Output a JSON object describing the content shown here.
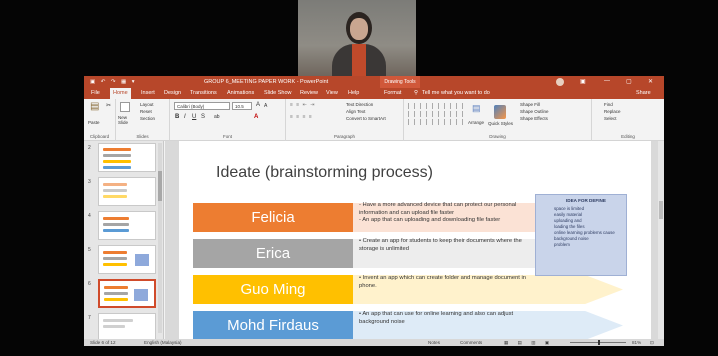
{
  "window": {
    "title": "GROUP 6_MEETING PAPER WORK - PowerPoint",
    "drawing_tools": "Drawing Tools",
    "quick_access": "▣ ↶ ↷ ▦ ▾",
    "min": "—",
    "max": "▢",
    "close": "✕",
    "ribbon_display": "▣"
  },
  "tabs": [
    {
      "label": "File"
    },
    {
      "label": "Home"
    },
    {
      "label": "Insert"
    },
    {
      "label": "Design"
    },
    {
      "label": "Transitions"
    },
    {
      "label": "Animations"
    },
    {
      "label": "Slide Show"
    },
    {
      "label": "Review"
    },
    {
      "label": "View"
    },
    {
      "label": "Help"
    },
    {
      "label": "Format"
    },
    {
      "label": "Tell me what you want to do"
    },
    {
      "label": "Share"
    }
  ],
  "ribbon": {
    "clipboard": {
      "label": "Clipboard",
      "paste": "Paste"
    },
    "slides": {
      "label": "Slides",
      "new_slide": "New Slide",
      "layout": "Layout",
      "reset": "Reset",
      "section": "Section"
    },
    "font": {
      "label": "Font",
      "font_name": "Calibri (Body)",
      "font_size": "10.5",
      "bold": "B",
      "italic": "I",
      "underline": "U",
      "strike": "S",
      "grow": "A",
      "shrink": "A",
      "font_color": "A",
      "highlight": "ab"
    },
    "paragraph": {
      "label": "Paragraph",
      "text_direction": "Text Direction",
      "align_text": "Align Text",
      "convert_smartart": "Convert to SmartArt"
    },
    "drawing": {
      "label": "Drawing",
      "arrange": "Arrange",
      "quick_styles": "Quick Styles",
      "shape_fill": "Shape Fill",
      "shape_outline": "Shape Outline",
      "shape_effects": "Shape Effects"
    },
    "editing": {
      "label": "Editing",
      "find": "Find",
      "replace": "Replace",
      "select": "Select"
    }
  },
  "thumbnails": [
    {
      "num": "2"
    },
    {
      "num": "3"
    },
    {
      "num": "4"
    },
    {
      "num": "5"
    },
    {
      "num": "6"
    },
    {
      "num": "7"
    }
  ],
  "slide": {
    "title": "Ideate (brainstorming process)",
    "rows": [
      {
        "name": "Felicia",
        "color": "#ed7d31",
        "arrow": "#fbe2d5",
        "lines": [
          "- Have a more advanced device that can protect our personal",
          "  information and can upload file faster",
          "- An app that can uploading and downloading file faster"
        ]
      },
      {
        "name": "Erica",
        "color": "#a5a5a5",
        "arrow": "#ededed",
        "lines": [
          "• Create an app for students to keep their documents where the",
          "  storage is unlimited"
        ]
      },
      {
        "name": "Guo Ming",
        "color": "#ffc000",
        "arrow": "#fff2cc",
        "lines": [
          "• Invent an app which can create folder and manage document in",
          "  phone."
        ]
      },
      {
        "name": "Mohd Firdaus",
        "color": "#5b9bd5",
        "arrow": "#deebf7",
        "lines": [
          "• An app that can use for online learning and also can adjust",
          "  background noise"
        ]
      }
    ],
    "callout": {
      "heading": "IDEA FOR DEFINE",
      "lines": [
        "space is limited",
        "  easily material",
        "uploading and",
        "  loading the files",
        "online learning problems cause",
        "  background noise",
        "  problem"
      ]
    }
  },
  "status": {
    "slide_of": "Slide 6 of 12",
    "language": "English (Malaysia)",
    "notes": "Notes",
    "comments": "Comments",
    "zoom": "81%"
  }
}
